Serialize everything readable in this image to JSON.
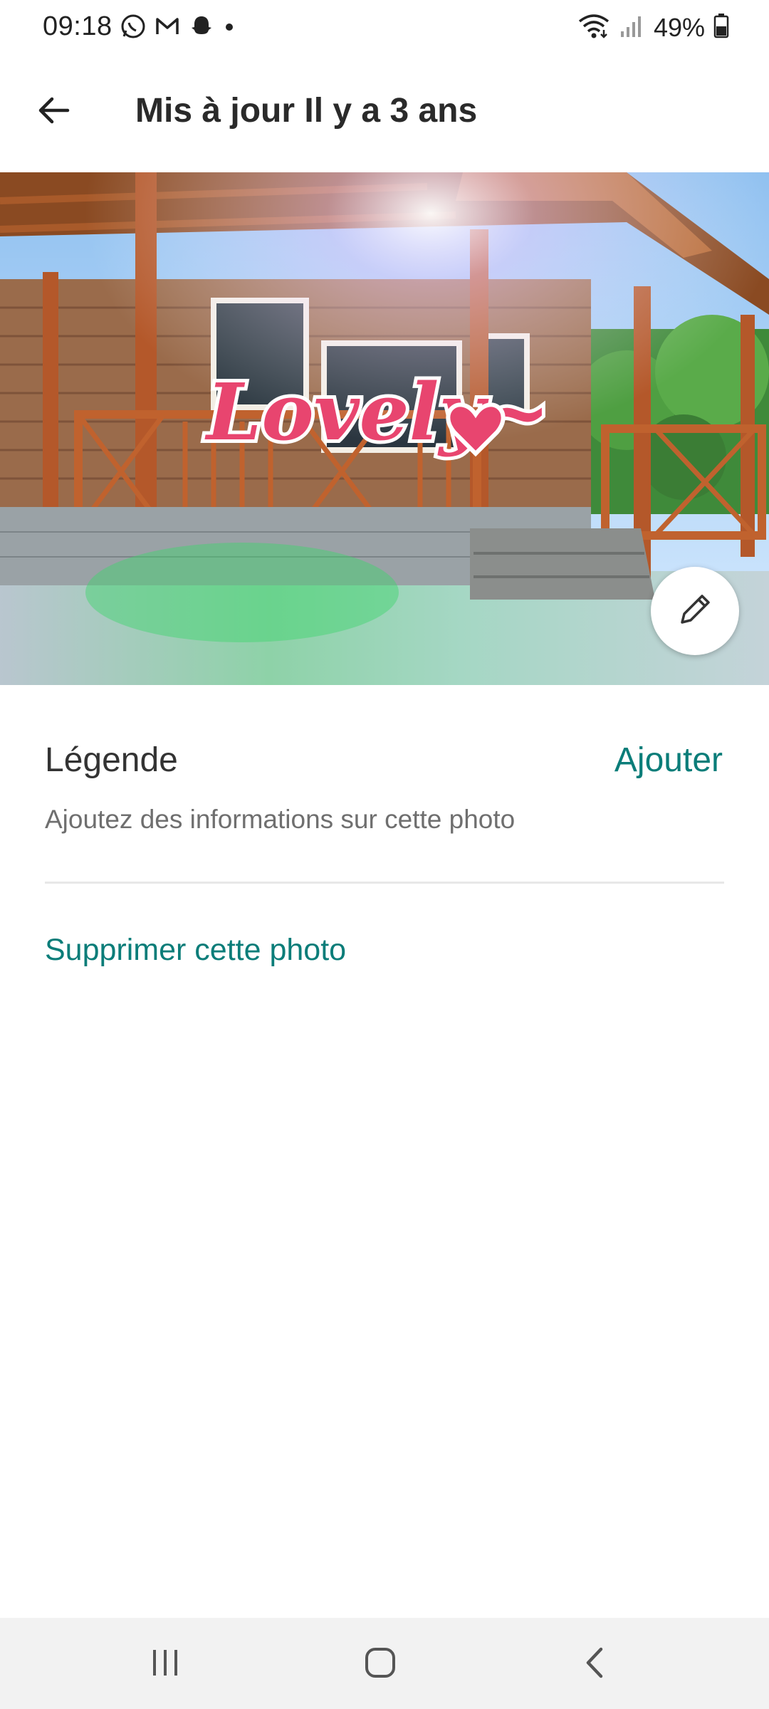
{
  "status_bar": {
    "time": "09:18",
    "notification_icons": [
      "whatsapp-icon",
      "gmail-icon",
      "snapchat-icon",
      "dot-icon"
    ],
    "battery": "49%",
    "right_icons": [
      "wifi-icon",
      "signal-icon",
      "battery-icon"
    ]
  },
  "app_bar": {
    "back_icon": "arrow-left-icon",
    "title": "Mis à jour Il y a 3 ans"
  },
  "photo": {
    "overlay_text": "Lovely~",
    "overlay_color": "#e8456f",
    "edit_icon": "pencil-icon"
  },
  "caption": {
    "label": "Légende",
    "add_label": "Ajouter",
    "hint": "Ajoutez des informations sur cette photo"
  },
  "actions": {
    "delete_label": "Supprimer cette photo"
  },
  "colors": {
    "accent": "#0b7d79",
    "nav_background": "#f2f2f2"
  },
  "nav_bar": {
    "buttons": [
      "recent-apps-icon",
      "home-icon",
      "back-icon"
    ]
  }
}
